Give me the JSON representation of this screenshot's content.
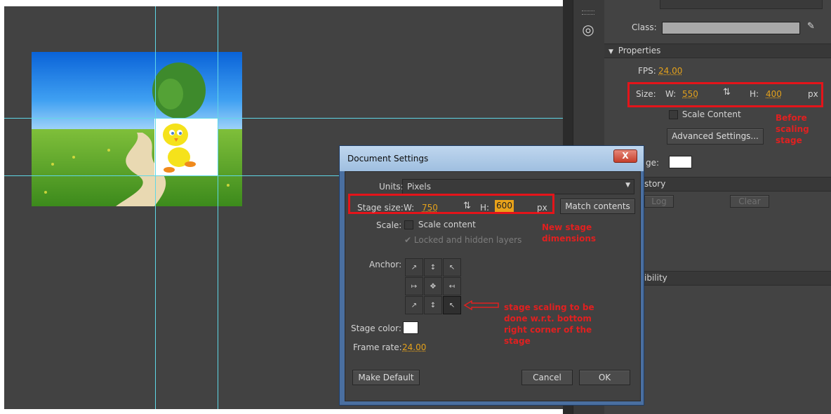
{
  "properties_panel": {
    "class_label": "Class:",
    "section_properties": "Properties",
    "fps_label": "FPS:",
    "fps_value": "24.00",
    "size_label": "Size:",
    "w_label": "W:",
    "w_value": "550",
    "h_label": "H:",
    "h_value": "400",
    "unit": "px",
    "scale_content_label": "Scale Content",
    "advanced_settings_label": "Advanced Settings...",
    "stage_label_partial": "ge:",
    "history_partial": "story",
    "log_label": "Log",
    "clear_label": "Clear",
    "accessibility_partial": "ibility"
  },
  "annotations": {
    "before": [
      "Before",
      "scaling",
      "stage"
    ],
    "new_dims": [
      "New stage",
      "dimensions"
    ],
    "anchor_note": [
      "stage scaling to be",
      "done w.r.t. bottom",
      "right corner of the",
      "stage"
    ]
  },
  "dialog": {
    "title": "Document Settings",
    "close_label": "X",
    "units_label": "Units:",
    "units_value": "Pixels",
    "stage_size_label": "Stage size:",
    "w_label": "W:",
    "w_value": "750",
    "h_label": "H:",
    "h_value": "600",
    "unit": "px",
    "match_contents_label": "Match contents",
    "scale_label": "Scale:",
    "scale_content_label": "Scale content",
    "locked_hidden_label": "Locked and hidden layers",
    "anchor_label": "Anchor:",
    "stage_color_label": "Stage color:",
    "frame_rate_label": "Frame rate:",
    "frame_rate_value": "24.00",
    "make_default_label": "Make Default",
    "cancel_label": "Cancel",
    "ok_label": "OK"
  },
  "colors": {
    "stage_bg": "#424242",
    "guide": "#5fd7e6",
    "accent_value": "#e4a11b",
    "annotation": "#e02020"
  }
}
